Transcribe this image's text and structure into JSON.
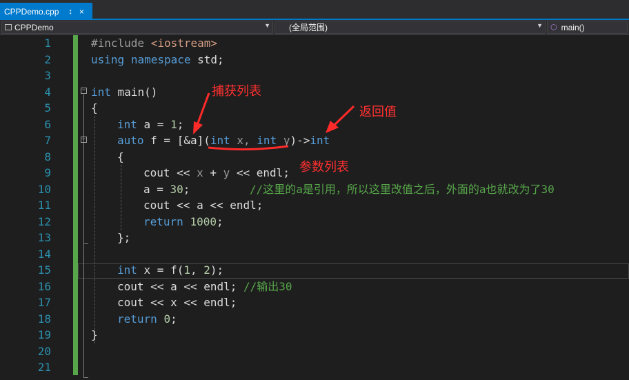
{
  "tab": {
    "title": "CPPDemo.cpp",
    "pin": "↕",
    "close": "×"
  },
  "nav": {
    "project": "CPPDemo",
    "scope": "(全局范围)",
    "member": "main()"
  },
  "line_numbers": [
    "1",
    "2",
    "3",
    "4",
    "5",
    "6",
    "7",
    "8",
    "9",
    "10",
    "11",
    "12",
    "13",
    "14",
    "15",
    "16",
    "17",
    "18",
    "19",
    "20",
    "21"
  ],
  "code": {
    "l1_a": "#include ",
    "l1_b": "<iostream>",
    "l2_a": "using",
    "l2_b": " ",
    "l2_c": "namespace",
    "l2_d": " std;",
    "l4_a": "int",
    "l4_b": " main()",
    "l5": "{",
    "l6_a": "int",
    "l6_b": " a = ",
    "l6_c": "1",
    "l6_d": ";",
    "l7_a": "auto",
    "l7_b": " f = [&a](",
    "l7_c": "int",
    "l7_d": " x, ",
    "l7_e": "int",
    "l7_f": " y",
    "l7_g": ")->",
    "l7_h": "int",
    "l8": "{",
    "l9_a": "cout << ",
    "l9_b": "x",
    "l9_c": " + ",
    "l9_d": "y",
    "l9_e": " << endl;",
    "l10_a": "a = ",
    "l10_b": "30",
    "l10_c": ";",
    "l10_d": "//这里的a是引用，所以这里改值之后，外面的a也就改为了30",
    "l11": "cout << a << endl;",
    "l12_a": "return",
    "l12_b": " ",
    "l12_c": "1000",
    "l12_d": ";",
    "l13": "};",
    "l15_a": "int",
    "l15_b": " x = f(",
    "l15_c": "1",
    "l15_d": ", ",
    "l15_e": "2",
    "l15_f": ");",
    "l16_a": "cout << a << endl; ",
    "l16_b": "//输出30",
    "l17": "cout << x << endl;",
    "l18_a": "return",
    "l18_b": " ",
    "l18_c": "0",
    "l18_d": ";",
    "l19": "}"
  },
  "annotations": {
    "capture": "捕获列表",
    "return_value": "返回值",
    "params": "参数列表"
  },
  "colors": {
    "keyword": "#569cd6",
    "comment": "#57a64a",
    "number": "#b5cea8",
    "annotation": "#ff3030",
    "accent": "#007acc"
  }
}
